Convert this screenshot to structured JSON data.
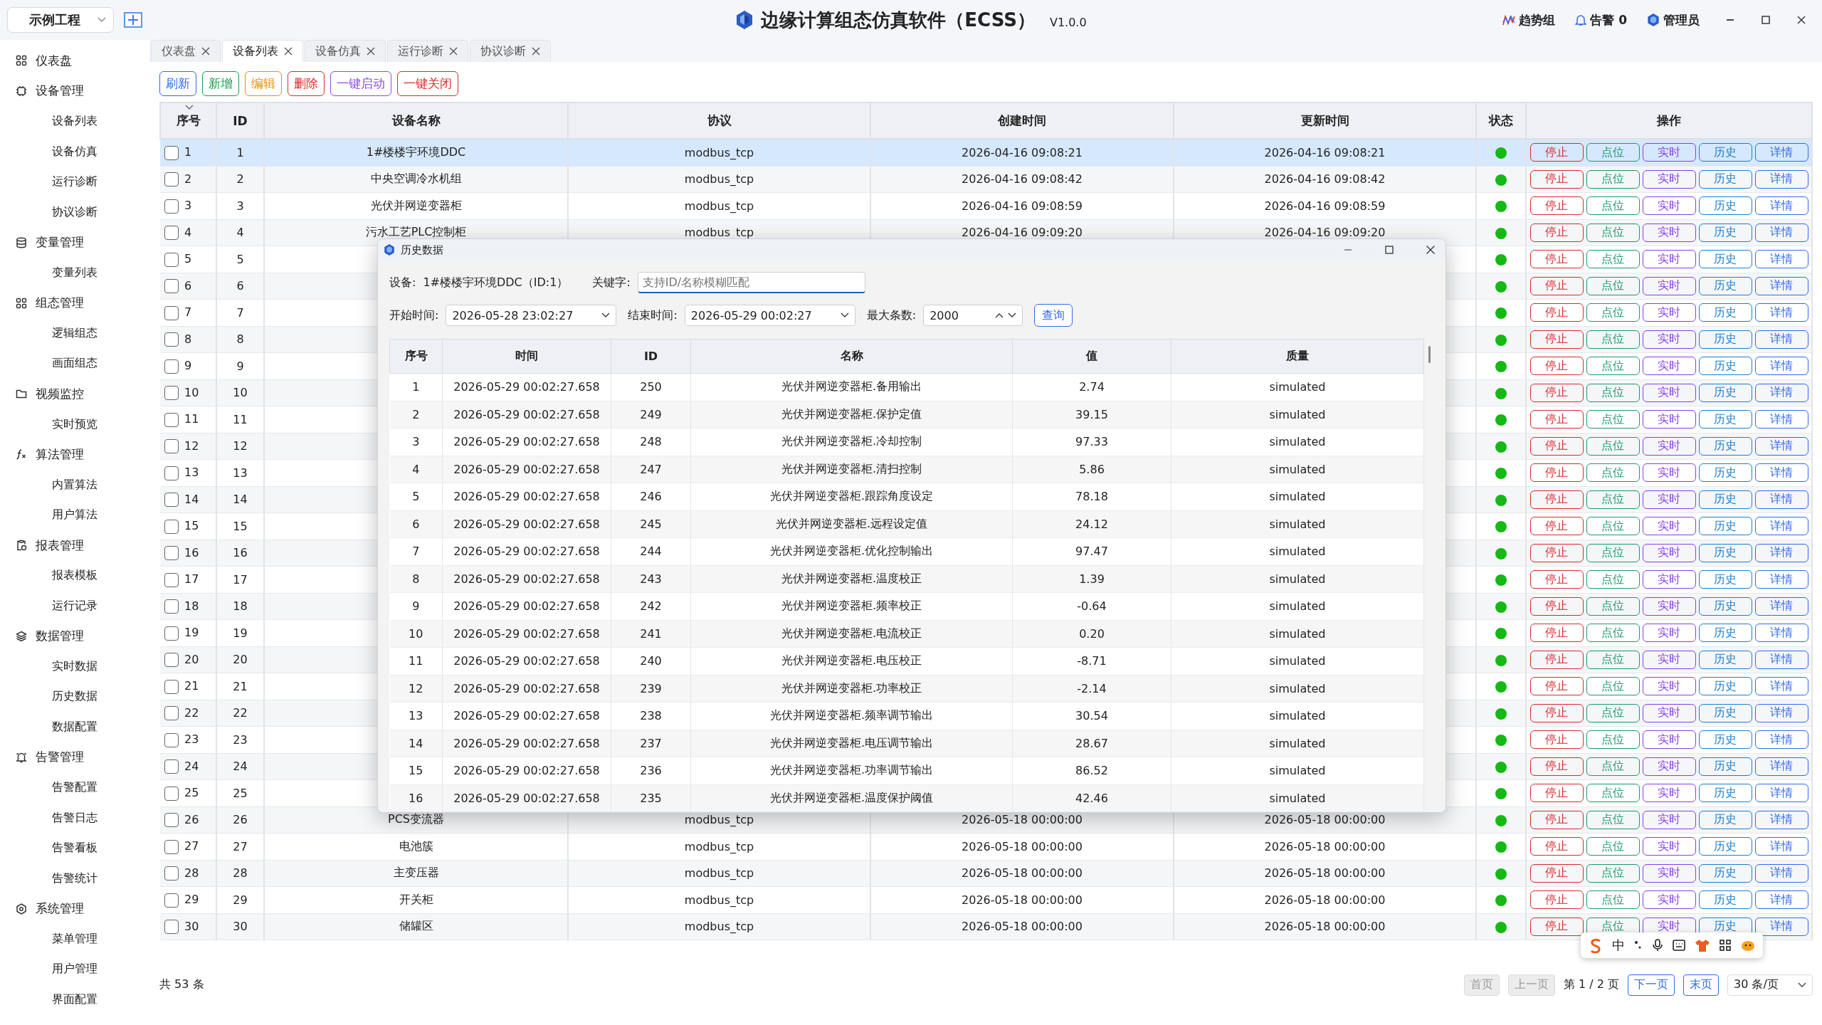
{
  "header": {
    "project": "示例工程",
    "title": "边缘计算组态仿真软件（ECSS）",
    "version": "V1.0.0",
    "trend": "趋势组",
    "alarm": "告警 0",
    "user": "管理员"
  },
  "sidebar": {
    "groups": [
      {
        "label": "仪表盘"
      },
      {
        "label": "设备管理",
        "children": [
          {
            "label": "设备列表"
          },
          {
            "label": "设备仿真"
          },
          {
            "label": "运行诊断"
          },
          {
            "label": "协议诊断"
          }
        ]
      },
      {
        "label": "变量管理",
        "children": [
          {
            "label": "变量列表"
          }
        ]
      },
      {
        "label": "组态管理",
        "children": [
          {
            "label": "逻辑组态"
          },
          {
            "label": "画面组态"
          }
        ]
      },
      {
        "label": "视频监控",
        "children": [
          {
            "label": "实时预览"
          }
        ]
      },
      {
        "label": "算法管理",
        "children": [
          {
            "label": "内置算法"
          },
          {
            "label": "用户算法"
          }
        ]
      },
      {
        "label": "报表管理",
        "children": [
          {
            "label": "报表模板"
          },
          {
            "label": "运行记录"
          }
        ]
      },
      {
        "label": "数据管理",
        "children": [
          {
            "label": "实时数据"
          },
          {
            "label": "历史数据"
          },
          {
            "label": "数据配置"
          }
        ]
      },
      {
        "label": "告警管理",
        "children": [
          {
            "label": "告警配置"
          },
          {
            "label": "告警日志"
          },
          {
            "label": "告警看板"
          },
          {
            "label": "告警统计"
          }
        ]
      },
      {
        "label": "系统管理",
        "children": [
          {
            "label": "菜单管理"
          },
          {
            "label": "用户管理"
          },
          {
            "label": "界面配置"
          }
        ]
      }
    ]
  },
  "tabs": [
    {
      "label": "仪表盘",
      "selected": false
    },
    {
      "label": "设备列表",
      "selected": true
    },
    {
      "label": "设备仿真",
      "selected": false
    },
    {
      "label": "运行诊断",
      "selected": false
    },
    {
      "label": "协议诊断",
      "selected": false
    }
  ],
  "toolbar": [
    {
      "label": "刷新",
      "color": "#2f6bea"
    },
    {
      "label": "新增",
      "color": "#1a9a4a"
    },
    {
      "label": "编辑",
      "color": "#f08c00"
    },
    {
      "label": "删除",
      "color": "#d92b2b"
    },
    {
      "label": "一键启动",
      "color": "#8a4de8"
    },
    {
      "label": "一键关闭",
      "color": "#d92b2b"
    }
  ],
  "table": {
    "columns": [
      "序号",
      "ID",
      "设备名称",
      "协议",
      "创建时间",
      "更新时间",
      "状态",
      "操作"
    ],
    "rows": [
      {
        "seq": "1",
        "id": "1",
        "name": "1#楼楼宇环境DDC",
        "protocol": "modbus_tcp",
        "created": "2026-04-16 09:08:21",
        "updated": "2026-04-16 09:08:21",
        "online": true,
        "checked": false,
        "selected": true,
        "actions": [
          "停止",
          "点位",
          "实时",
          "历史",
          "详情"
        ]
      },
      {
        "seq": "2",
        "id": "2",
        "name": "中央空调冷水机组",
        "protocol": "modbus_tcp",
        "created": "2026-04-16 09:08:42",
        "updated": "2026-04-16 09:08:42",
        "online": true,
        "checked": false,
        "selected": false,
        "actions": [
          "停止",
          "点位",
          "实时",
          "历史",
          "详情"
        ]
      },
      {
        "seq": "3",
        "id": "3",
        "name": "光伏并网逆变器柜",
        "protocol": "modbus_tcp",
        "created": "2026-04-16 09:08:59",
        "updated": "2026-04-16 09:08:59",
        "online": true,
        "checked": false,
        "selected": false,
        "actions": [
          "停止",
          "点位",
          "实时",
          "历史",
          "详情"
        ]
      },
      {
        "seq": "4",
        "id": "4",
        "name": "污水工艺PLC控制柜",
        "protocol": "modbus_tcp",
        "created": "2026-04-16 09:09:20",
        "updated": "2026-04-16 09:09:20",
        "online": true,
        "checked": false,
        "selected": false,
        "actions": [
          "停止",
          "点位",
          "实时",
          "历史",
          "详情"
        ]
      },
      {
        "seq": "5",
        "id": "5",
        "online": true,
        "checked": false,
        "selected": false,
        "actions": [
          "停止",
          "点位",
          "实时",
          "历史",
          "详情"
        ]
      },
      {
        "seq": "6",
        "id": "6",
        "online": true,
        "checked": false,
        "selected": false,
        "actions": [
          "停止",
          "点位",
          "实时",
          "历史",
          "详情"
        ]
      },
      {
        "seq": "7",
        "id": "7",
        "online": true,
        "checked": false,
        "selected": false,
        "actions": [
          "停止",
          "点位",
          "实时",
          "历史",
          "详情"
        ]
      },
      {
        "seq": "8",
        "id": "8",
        "online": true,
        "checked": false,
        "selected": false,
        "actions": [
          "停止",
          "点位",
          "实时",
          "历史",
          "详情"
        ]
      },
      {
        "seq": "9",
        "id": "9",
        "online": true,
        "checked": false,
        "selected": false,
        "actions": [
          "停止",
          "点位",
          "实时",
          "历史",
          "详情"
        ]
      },
      {
        "seq": "10",
        "id": "10",
        "online": true,
        "checked": false,
        "selected": false,
        "actions": [
          "停止",
          "点位",
          "实时",
          "历史",
          "详情"
        ]
      },
      {
        "seq": "11",
        "id": "11",
        "online": true,
        "checked": false,
        "selected": false,
        "actions": [
          "停止",
          "点位",
          "实时",
          "历史",
          "详情"
        ]
      },
      {
        "seq": "12",
        "id": "12",
        "online": true,
        "checked": false,
        "selected": false,
        "actions": [
          "停止",
          "点位",
          "实时",
          "历史",
          "详情"
        ]
      },
      {
        "seq": "13",
        "id": "13",
        "online": true,
        "checked": false,
        "selected": false,
        "actions": [
          "停止",
          "点位",
          "实时",
          "历史",
          "详情"
        ]
      },
      {
        "seq": "14",
        "id": "14",
        "online": true,
        "checked": false,
        "selected": false,
        "actions": [
          "停止",
          "点位",
          "实时",
          "历史",
          "详情"
        ]
      },
      {
        "seq": "15",
        "id": "15",
        "online": true,
        "checked": false,
        "selected": false,
        "actions": [
          "停止",
          "点位",
          "实时",
          "历史",
          "详情"
        ]
      },
      {
        "seq": "16",
        "id": "16",
        "online": true,
        "checked": false,
        "selected": false,
        "actions": [
          "停止",
          "点位",
          "实时",
          "历史",
          "详情"
        ]
      },
      {
        "seq": "17",
        "id": "17",
        "online": true,
        "checked": false,
        "selected": false,
        "actions": [
          "停止",
          "点位",
          "实时",
          "历史",
          "详情"
        ]
      },
      {
        "seq": "18",
        "id": "18",
        "online": true,
        "checked": false,
        "selected": false,
        "actions": [
          "停止",
          "点位",
          "实时",
          "历史",
          "详情"
        ]
      },
      {
        "seq": "19",
        "id": "19",
        "online": true,
        "checked": false,
        "selected": false,
        "actions": [
          "停止",
          "点位",
          "实时",
          "历史",
          "详情"
        ]
      },
      {
        "seq": "20",
        "id": "20",
        "online": true,
        "checked": false,
        "selected": false,
        "actions": [
          "停止",
          "点位",
          "实时",
          "历史",
          "详情"
        ]
      },
      {
        "seq": "21",
        "id": "21",
        "online": true,
        "checked": false,
        "selected": false,
        "actions": [
          "停止",
          "点位",
          "实时",
          "历史",
          "详情"
        ]
      },
      {
        "seq": "22",
        "id": "22",
        "online": true,
        "checked": false,
        "selected": false,
        "actions": [
          "停止",
          "点位",
          "实时",
          "历史",
          "详情"
        ]
      },
      {
        "seq": "23",
        "id": "23",
        "online": true,
        "checked": false,
        "selected": false,
        "actions": [
          "停止",
          "点位",
          "实时",
          "历史",
          "详情"
        ]
      },
      {
        "seq": "24",
        "id": "24",
        "online": true,
        "checked": false,
        "selected": false,
        "actions": [
          "停止",
          "点位",
          "实时",
          "历史",
          "详情"
        ]
      },
      {
        "seq": "25",
        "id": "25",
        "online": true,
        "checked": false,
        "selected": false,
        "actions": [
          "停止",
          "点位",
          "实时",
          "历史",
          "详情"
        ]
      },
      {
        "seq": "26",
        "id": "26",
        "name": "PCS变流器",
        "protocol": "modbus_tcp",
        "created": "2026-05-18 00:00:00",
        "updated": "2026-05-18 00:00:00",
        "online": true,
        "checked": false,
        "selected": false,
        "actions": [
          "停止",
          "点位",
          "实时",
          "历史",
          "详情"
        ]
      },
      {
        "seq": "27",
        "id": "27",
        "name": "电池簇",
        "protocol": "modbus_tcp",
        "created": "2026-05-18 00:00:00",
        "updated": "2026-05-18 00:00:00",
        "online": true,
        "checked": false,
        "selected": false,
        "actions": [
          "停止",
          "点位",
          "实时",
          "历史",
          "详情"
        ]
      },
      {
        "seq": "28",
        "id": "28",
        "name": "主变压器",
        "protocol": "modbus_tcp",
        "created": "2026-05-18 00:00:00",
        "updated": "2026-05-18 00:00:00",
        "online": true,
        "checked": false,
        "selected": false,
        "actions": [
          "停止",
          "点位",
          "实时",
          "历史",
          "详情"
        ]
      },
      {
        "seq": "29",
        "id": "29",
        "name": "开关柜",
        "protocol": "modbus_tcp",
        "created": "2026-05-18 00:00:00",
        "updated": "2026-05-18 00:00:00",
        "online": true,
        "checked": false,
        "selected": false,
        "actions": [
          "停止",
          "点位",
          "实时",
          "历史",
          "详情"
        ]
      },
      {
        "seq": "30",
        "id": "30",
        "name": "储罐区",
        "protocol": "modbus_tcp",
        "created": "2026-05-18 00:00:00",
        "updated": "2026-05-18 00:00:00",
        "online": true,
        "checked": false,
        "selected": false,
        "actions": [
          "停止",
          "点位",
          "实时",
          "历史",
          "详情"
        ]
      }
    ]
  },
  "footer": {
    "total": "共 53 条",
    "first": {
      "label": "首页",
      "disabled": true
    },
    "prev": {
      "label": "上一页",
      "disabled": true
    },
    "page": "第 1 / 2 页",
    "next": {
      "label": "下一页",
      "disabled": false
    },
    "last": {
      "label": "末页",
      "disabled": false
    },
    "page_size": "30 条/页"
  },
  "dialog": {
    "title": "历史数据",
    "device_label": "设备:",
    "device": "1#楼楼宇环境DDC（ID:1）",
    "keyword_label": "关键字:",
    "keyword_placeholder": "支持ID/名称模糊匹配",
    "start_label": "开始时间:",
    "start": "2026-05-28 23:02:27",
    "end_label": "结束时间:",
    "end": "2026-05-29 00:02:27",
    "max_label": "最大条数:",
    "max": "2000",
    "query": "查询",
    "columns": [
      "序号",
      "时间",
      "ID",
      "名称",
      "值",
      "质量"
    ],
    "rows": [
      [
        "1",
        "2026-05-29 00:02:27.658",
        "250",
        "光伏并网逆变器柜.备用输出",
        "2.74",
        "simulated"
      ],
      [
        "2",
        "2026-05-29 00:02:27.658",
        "249",
        "光伏并网逆变器柜.保护定值",
        "39.15",
        "simulated"
      ],
      [
        "3",
        "2026-05-29 00:02:27.658",
        "248",
        "光伏并网逆变器柜.冷却控制",
        "97.33",
        "simulated"
      ],
      [
        "4",
        "2026-05-29 00:02:27.658",
        "247",
        "光伏并网逆变器柜.清扫控制",
        "5.86",
        "simulated"
      ],
      [
        "5",
        "2026-05-29 00:02:27.658",
        "246",
        "光伏并网逆变器柜.跟踪角度设定",
        "78.18",
        "simulated"
      ],
      [
        "6",
        "2026-05-29 00:02:27.658",
        "245",
        "光伏并网逆变器柜.远程设定值",
        "24.12",
        "simulated"
      ],
      [
        "7",
        "2026-05-29 00:02:27.658",
        "244",
        "光伏并网逆变器柜.优化控制输出",
        "97.47",
        "simulated"
      ],
      [
        "8",
        "2026-05-29 00:02:27.658",
        "243",
        "光伏并网逆变器柜.温度校正",
        "1.39",
        "simulated"
      ],
      [
        "9",
        "2026-05-29 00:02:27.658",
        "242",
        "光伏并网逆变器柜.频率校正",
        "-0.64",
        "simulated"
      ],
      [
        "10",
        "2026-05-29 00:02:27.658",
        "241",
        "光伏并网逆变器柜.电流校正",
        "0.20",
        "simulated"
      ],
      [
        "11",
        "2026-05-29 00:02:27.658",
        "240",
        "光伏并网逆变器柜.电压校正",
        "-8.71",
        "simulated"
      ],
      [
        "12",
        "2026-05-29 00:02:27.658",
        "239",
        "光伏并网逆变器柜.功率校正",
        "-2.14",
        "simulated"
      ],
      [
        "13",
        "2026-05-29 00:02:27.658",
        "238",
        "光伏并网逆变器柜.频率调节输出",
        "30.54",
        "simulated"
      ],
      [
        "14",
        "2026-05-29 00:02:27.658",
        "237",
        "光伏并网逆变器柜.电压调节输出",
        "28.67",
        "simulated"
      ],
      [
        "15",
        "2026-05-29 00:02:27.658",
        "236",
        "光伏并网逆变器柜.功率调节输出",
        "86.52",
        "simulated"
      ],
      [
        "16",
        "2026-05-29 00:02:27.658",
        "235",
        "光伏并网逆变器柜.温度保护阈值",
        "42.46",
        "simulated"
      ]
    ]
  },
  "ime_toolbar": {
    "mode": "中"
  }
}
